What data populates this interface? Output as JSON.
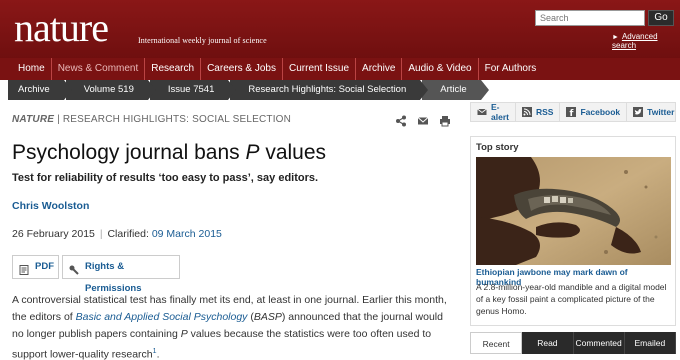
{
  "header": {
    "logo": "nature",
    "tagline": "International weekly journal of science",
    "search_placeholder": "Search",
    "go_label": "Go",
    "advanced_search": "Advanced search"
  },
  "nav": {
    "items": [
      "Home",
      "News & Comment",
      "Research",
      "Careers & Jobs",
      "Current Issue",
      "Archive",
      "Audio & Video",
      "For Authors"
    ],
    "active_index": 1
  },
  "breadcrumb": [
    "Archive",
    "Volume 519",
    "Issue 7541",
    "Research Highlights: Social Selection",
    "Article"
  ],
  "article": {
    "kicker_journal": "NATURE",
    "kicker_section": "RESEARCH HIGHLIGHTS: SOCIAL SELECTION",
    "title_main": "Psychology journal bans ",
    "title_italic": "P",
    "title_end": " values",
    "standfirst": "Test for reliability of results ‘too easy to pass’, say editors.",
    "author": "Chris Woolston",
    "published": "26 February 2015",
    "clarified_label": "Clarified:",
    "clarified_date": "09 March 2015",
    "pdf_label": "PDF",
    "rights_label": "Rights & Permissions",
    "body_1": "A controversial statistical test has finally met its end, at least in one journal. Earlier this month, the editors of ",
    "body_link": "Basic and Applied Social Psychology",
    "body_2": " (",
    "body_abbr": "BASP",
    "body_3": ") announced that the journal would no longer publish papers containing ",
    "body_p": "P",
    "body_4": " values because the statistics were too often used to support lower-quality research",
    "body_ref": "1",
    "body_5": "."
  },
  "sidebar": {
    "share_links": [
      {
        "label": "E-alert",
        "icon": "email-alert-icon"
      },
      {
        "label": "RSS",
        "icon": "rss-icon"
      },
      {
        "label": "Facebook",
        "icon": "facebook-icon"
      },
      {
        "label": "Twitter",
        "icon": "twitter-icon"
      }
    ],
    "top_story_heading": "Top story",
    "top_story_headline": "Ethiopian jawbone may mark dawn of humankind",
    "top_story_summary": "A 2.8-million-year-old mandible and a digital model of a key fossil paint a complicated picture of the genus Homo.",
    "tabs": [
      "Recent",
      "Read",
      "Commented",
      "Emailed"
    ],
    "active_tab": 0
  },
  "colors": {
    "masthead": "#7a1212",
    "link": "#1a5c93",
    "breadcrumb": "#3a3a3a"
  }
}
